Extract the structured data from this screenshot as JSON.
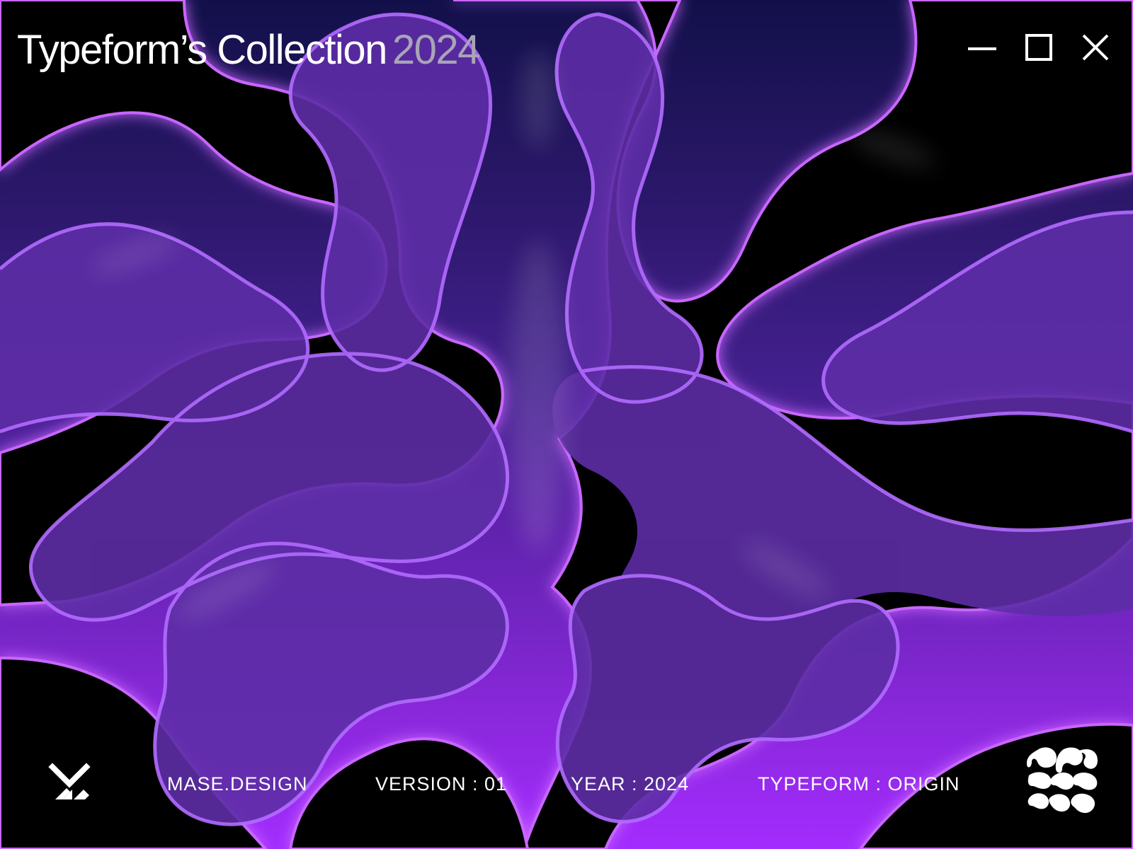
{
  "window": {
    "title": "Typeform’s Collection",
    "year": "2024",
    "controls": {
      "minimize": "minimize-icon",
      "maximize": "maximize-icon",
      "close": "close-icon"
    }
  },
  "footer": {
    "site": "MASE.DESIGN",
    "version": "VERSION : 01",
    "year": "YEAR : 2024",
    "typeform": "TYPEFORM : ORIGIN"
  },
  "icons": {
    "brand_mark": "brand-mark-icon",
    "logo_mark": "logo-mark-icon"
  },
  "colors": {
    "top": "#12104a",
    "bottom": "#a32cff",
    "glow": "#c866ff",
    "text": "#ffffff",
    "year_text": "#a9a4b7"
  }
}
